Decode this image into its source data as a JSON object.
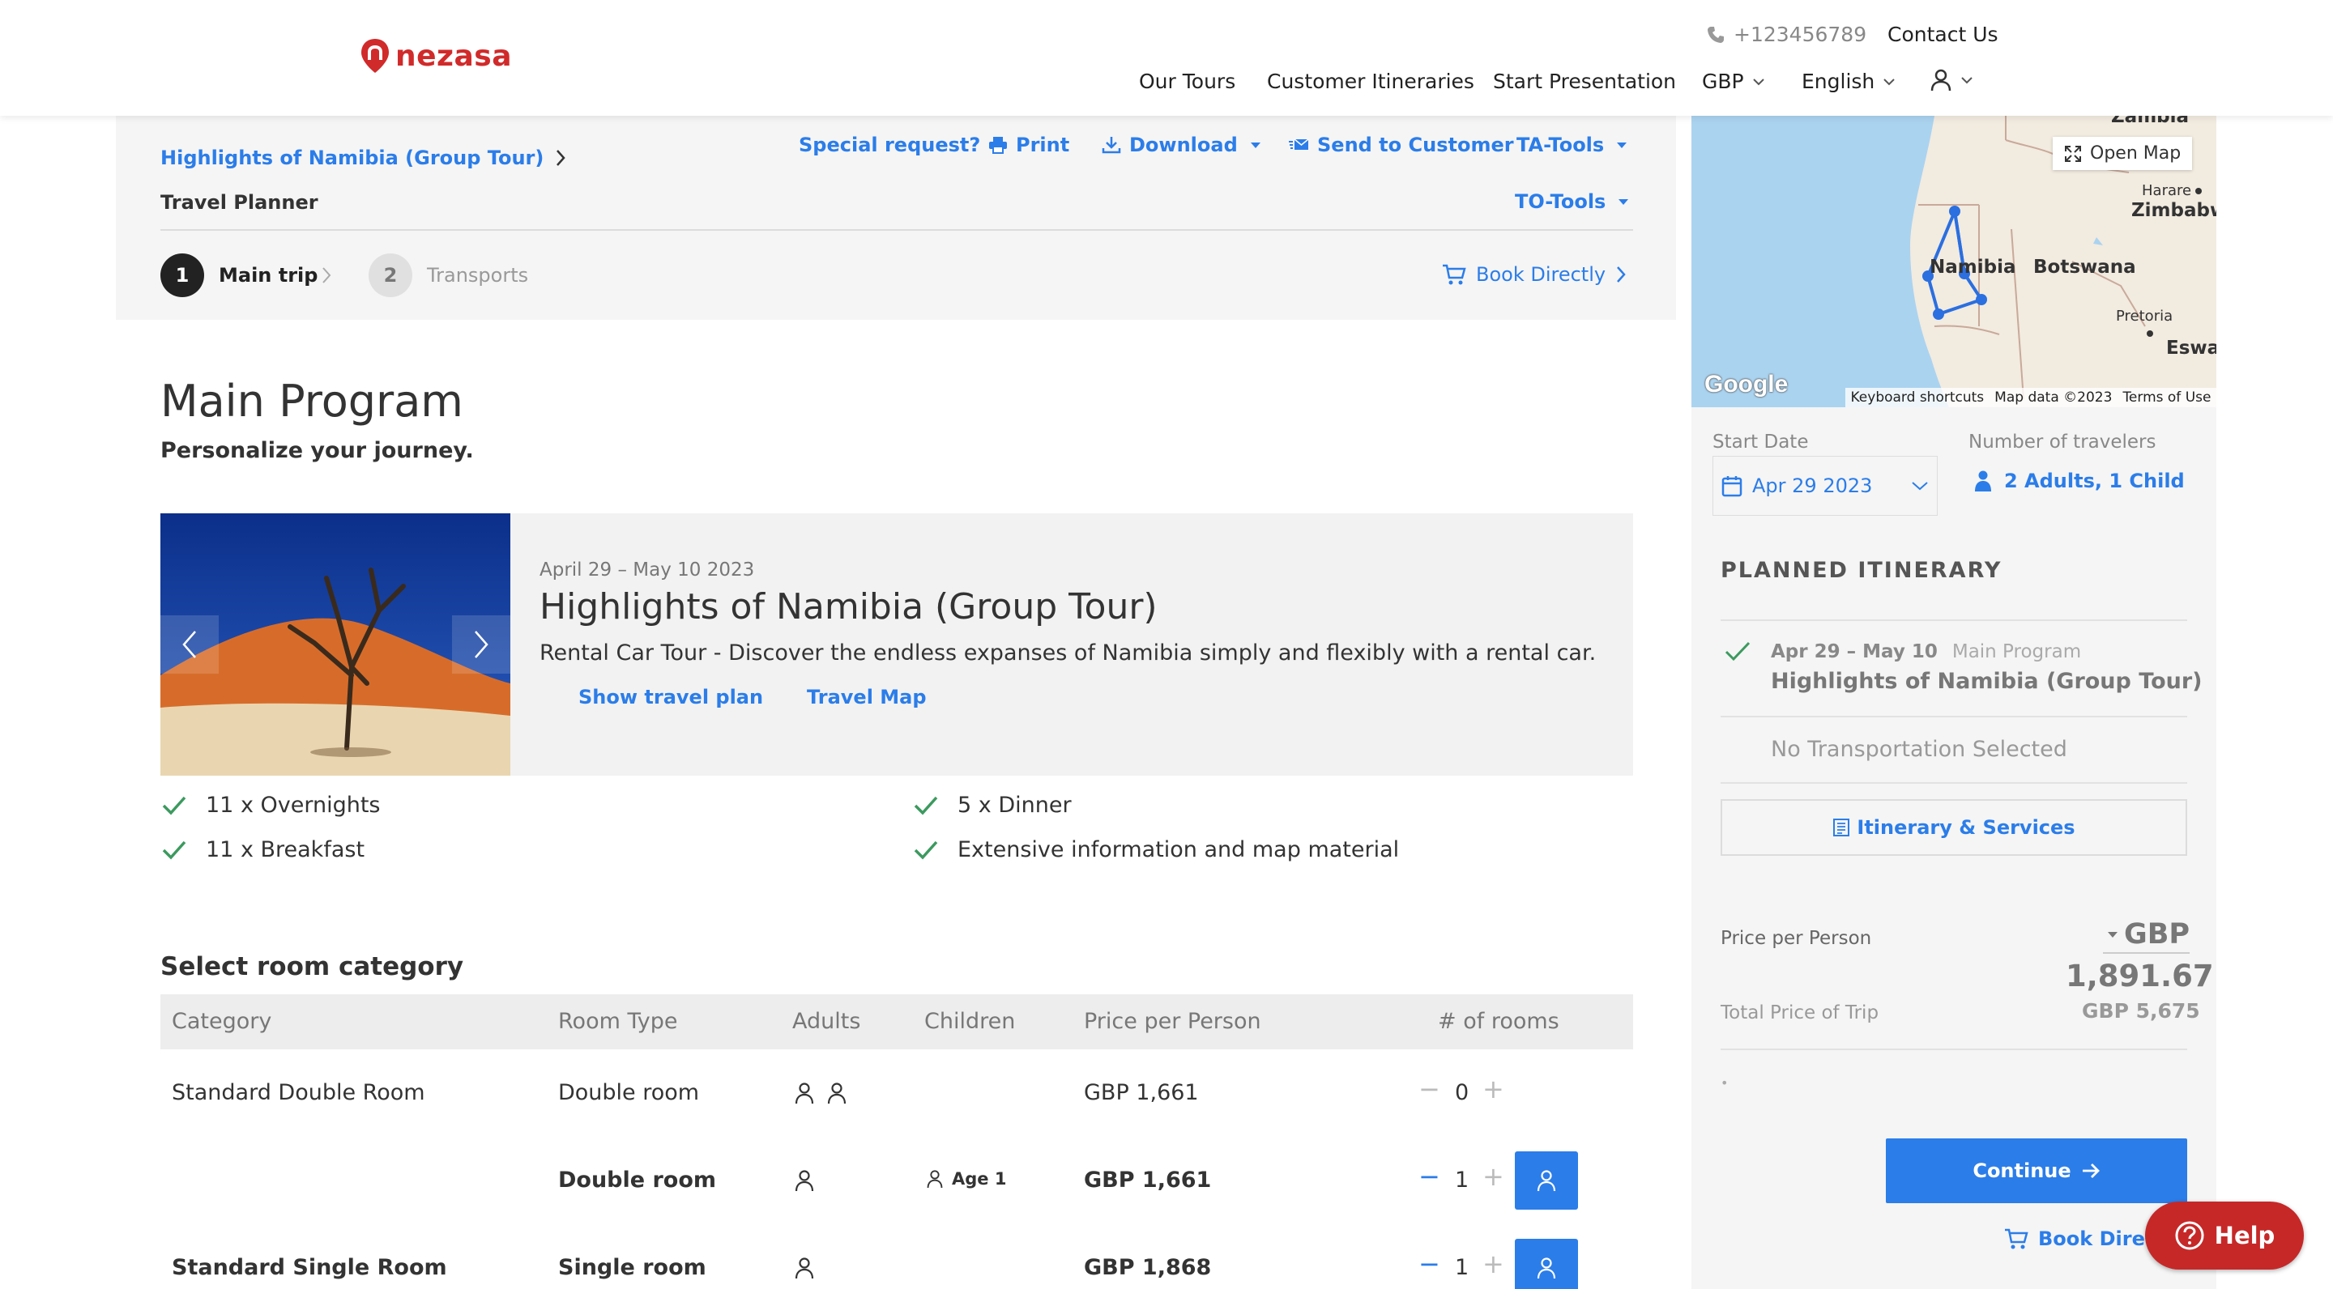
{
  "brand": {
    "name": "nezasa",
    "color": "#d12a2a"
  },
  "accent_color": "#2b7de9",
  "topbar": {
    "phone": "+123456789",
    "contact": "Contact Us",
    "nav": [
      "Our Tours",
      "Customer Itineraries",
      "Start Presentation"
    ],
    "currency": "GBP",
    "language": "English",
    "icons": [
      "phone-icon",
      "user-icon",
      "chevron-down-icon"
    ]
  },
  "header": {
    "breadcrumb": "Highlights of Namibia (Group Tour)",
    "sublabel": "Travel Planner",
    "tools": {
      "special": "Special request?",
      "print": "Print",
      "download": "Download",
      "send": "Send to Customer",
      "ta_tools": "TA-Tools",
      "to_tools": "TO-Tools"
    },
    "steps": [
      {
        "num": "1",
        "label": "Main trip"
      },
      {
        "num": "2",
        "label": "Transports"
      }
    ],
    "book_directly": "Book Directly"
  },
  "main": {
    "title": "Main Program",
    "subtitle": "Personalize your journey.",
    "tour": {
      "dates": "April 29 – May 10 2023",
      "title": "Highlights of Namibia (Group Tour)",
      "description": "Rental Car Tour - Discover the endless expanses of Namibia simply and flexibly with a rental car.",
      "links": {
        "plan": "Show travel plan",
        "map": "Travel Map"
      }
    },
    "inclusions": {
      "left": [
        "11 x Overnights",
        "11 x Breakfast"
      ],
      "right": [
        "5 x Dinner",
        "Extensive information and map material"
      ]
    }
  },
  "rooms": {
    "title": "Select room category",
    "headers": [
      "Category",
      "Room Type",
      "Adults",
      "Children",
      "Price per Person",
      "# of rooms"
    ],
    "rows": [
      {
        "category": "Standard Double Room",
        "type": "Double room",
        "adults": 2,
        "children": "",
        "price": "GBP 1,661",
        "qty": "0"
      },
      {
        "category": "",
        "type": "Double room",
        "adults": 1,
        "children": "Age 1",
        "price": "GBP 1,661",
        "qty": "1"
      },
      {
        "category": "Standard Single Room",
        "type": "Single room",
        "adults": 1,
        "children": "",
        "price": "GBP 1,868",
        "qty": "1"
      }
    ]
  },
  "map": {
    "labels": {
      "zambia": "Zambia",
      "harare": "Harare",
      "zimbabwe": "Zimbabw",
      "namibia": "Namibia",
      "botswana": "Botswana",
      "pretoria": "Pretoria",
      "eswatini": "Eswa"
    },
    "open_map": "Open Map",
    "google": "Google",
    "footer": [
      "Keyboard shortcuts",
      "Map data ©2023",
      "Terms of Use"
    ]
  },
  "sidebar": {
    "start_date_label": "Start Date",
    "start_date": "Apr 29 2023",
    "travelers_label": "Number of travelers",
    "travelers": "2 Adults, 1 Child",
    "planned_title": "PLANNED ITINERARY",
    "item": {
      "dates": "Apr 29 – May 10",
      "type": "Main Program",
      "title": "Highlights of Namibia (Group Tour)"
    },
    "no_transport": "No Transportation Selected",
    "itinerary_btn": "Itinerary & Services",
    "price_per_person_label": "Price per Person",
    "currency": "GBP",
    "price_per_person": "1,891.67",
    "total_label": "Total Price of Trip",
    "total": "GBP 5,675",
    "dot": "•",
    "continue": "Continue",
    "book_directly": "Book Directly"
  },
  "help": "Help"
}
